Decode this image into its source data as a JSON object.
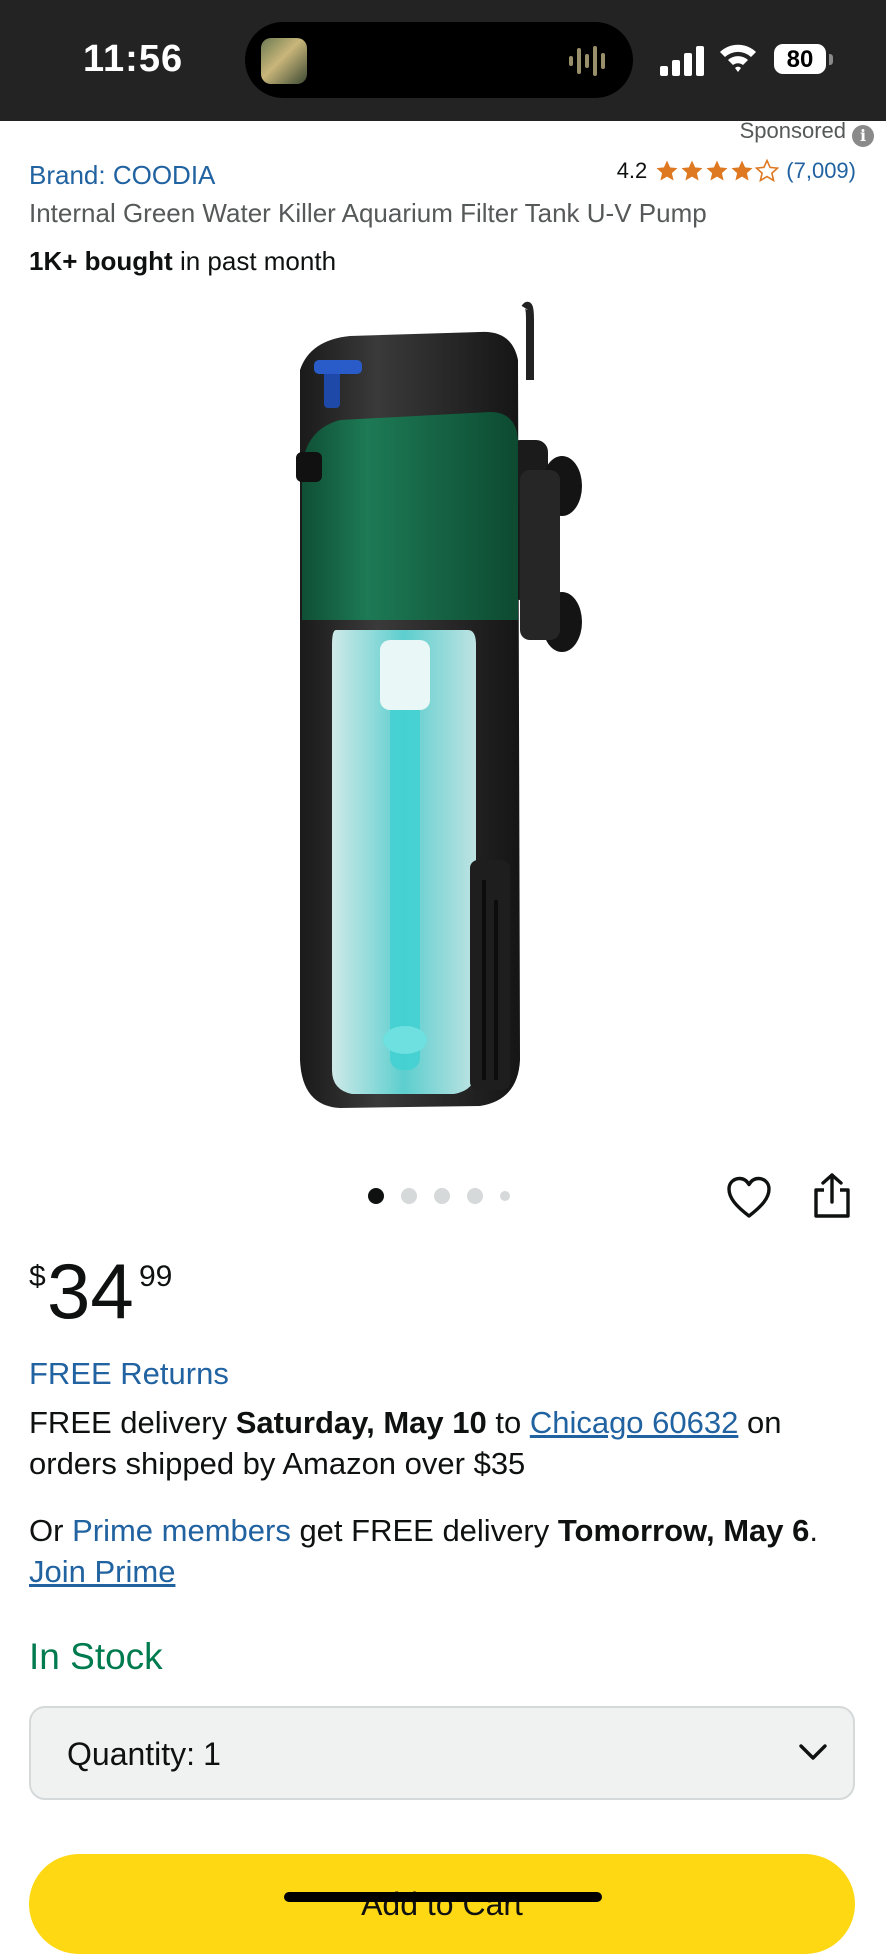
{
  "status_bar": {
    "time": "11:56",
    "battery": "80",
    "icons": [
      "now-playing-thumbnail",
      "audio-wave-icon",
      "signal-icon",
      "wifi-icon",
      "battery-icon"
    ]
  },
  "ad": {
    "sponsored_label": "Sponsored",
    "info_icon": "i"
  },
  "product": {
    "brand": "Brand: COODIA",
    "rating": "4.2",
    "stars": 4.2,
    "review_count": "(7,009)",
    "title": "Internal Green Water Killer Aquarium Filter Tank U-V Pump",
    "bought_bold": "1K+ bought",
    "bought_rest": " in past month",
    "image_name": "aquarium-uv-filter-pump-image",
    "gallery_page": 1,
    "gallery_total": 5
  },
  "price": {
    "symbol": "$",
    "whole": "34",
    "fraction": "99"
  },
  "shipping": {
    "free_returns": "FREE Returns",
    "delivery_prefix": "FREE delivery ",
    "delivery_date": "Saturday, May 10",
    "delivery_to": " to ",
    "location": "Chicago 60632",
    "delivery_suffix": " on orders shipped by Amazon over $35",
    "prime_prefix": "Or ",
    "prime_members": "Prime members",
    "prime_middle": " get FREE delivery ",
    "prime_date": "Tomorrow, May 6",
    "prime_end": ".",
    "join_prime": "Join Prime"
  },
  "availability": {
    "in_stock": "In Stock"
  },
  "quantity": {
    "label": "Quantity:",
    "value": "1"
  },
  "buttons": {
    "add_to_cart": "Add to Cart"
  },
  "colors": {
    "link": "#2162a1",
    "star": "#de7921",
    "in_stock": "#007b4f",
    "add_to_cart": "#ffd814",
    "status_bar": "#232323"
  }
}
